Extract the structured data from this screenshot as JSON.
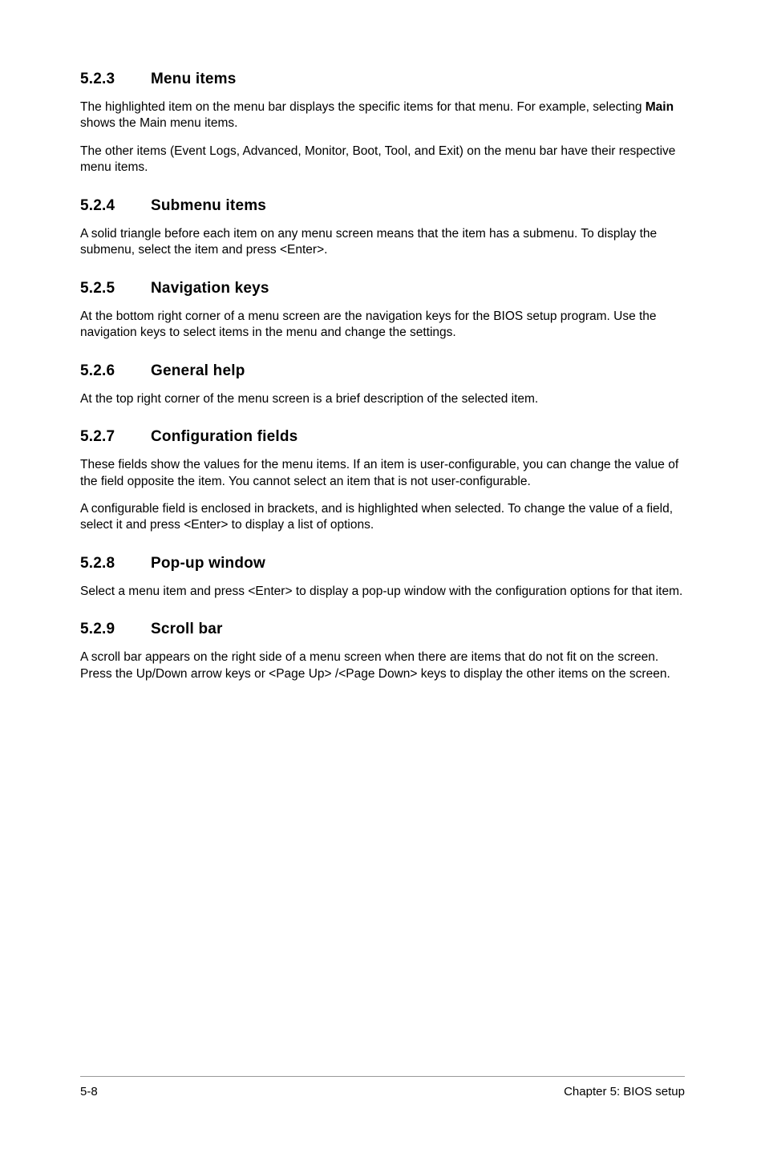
{
  "sections": [
    {
      "num": "5.2.3",
      "title": "Menu items",
      "paras": [
        {
          "pre": "The highlighted item on the menu bar displays the specific items for that menu. For example, selecting ",
          "bold": "Main",
          "post": " shows the Main menu items."
        },
        {
          "text": "The other items (Event Logs, Advanced, Monitor, Boot, Tool, and Exit) on the menu bar have their respective menu items."
        }
      ]
    },
    {
      "num": "5.2.4",
      "title": "Submenu items",
      "paras": [
        {
          "text": "A solid triangle before each item on any menu screen means that the item has a submenu. To display the submenu, select the item and press <Enter>."
        }
      ]
    },
    {
      "num": "5.2.5",
      "title": "Navigation keys",
      "paras": [
        {
          "text": "At the bottom right corner of a menu screen are the navigation keys for the BIOS setup program. Use the navigation keys to select items in the menu and change the settings."
        }
      ]
    },
    {
      "num": "5.2.6",
      "title": "General help",
      "paras": [
        {
          "text": "At the top right corner of the menu screen is a brief description of the selected item."
        }
      ]
    },
    {
      "num": "5.2.7",
      "title": "Configuration fields",
      "paras": [
        {
          "text": "These fields show the values for the menu items. If an item is user-configurable, you can change the value of the field opposite the item. You cannot select an item that is not user-configurable."
        },
        {
          "text": "A configurable field is enclosed in brackets, and is highlighted when selected. To change the value of a field, select it and press <Enter> to display a list of options."
        }
      ]
    },
    {
      "num": "5.2.8",
      "title": "Pop-up window",
      "paras": [
        {
          "text": "Select a menu item and press <Enter> to display a pop-up window with the configuration options for that item."
        }
      ]
    },
    {
      "num": "5.2.9",
      "title": "Scroll bar",
      "paras": [
        {
          "text": "A scroll bar appears on the right side of a menu screen when there are items that do not fit on the screen. Press the Up/Down arrow keys or <Page Up> /<Page Down> keys to display the other items on the screen."
        }
      ]
    }
  ],
  "footer": {
    "left": "5-8",
    "right": "Chapter 5: BIOS setup"
  }
}
